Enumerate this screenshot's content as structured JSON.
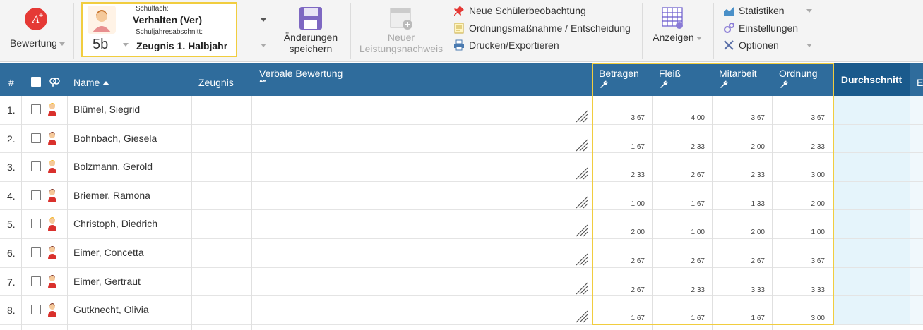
{
  "toolbar": {
    "bewertung_label": "Bewertung",
    "schulfach_caption": "Schulfach:",
    "schulfach_value": "Verhalten (Ver)",
    "abschnitt_caption": "Schuljahresabschnitt:",
    "abschnitt_value": "Zeugnis 1. Halbjahr",
    "klasse": "5b",
    "save_line1": "Änderungen",
    "save_line2": "speichern",
    "neuer_line1": "Neuer",
    "neuer_line2": "Leistungsnachweis",
    "link1": "Neue Schülerbeobachtung",
    "link2": "Ordnungsmaßnahme / Entscheidung",
    "link3": "Drucken/Exportieren",
    "anzeigen": "Anzeigen",
    "statistiken": "Statistiken",
    "einstellungen": "Einstellungen",
    "optionen": "Optionen",
    "colors": {
      "accent": "#2f6c9c",
      "highlight": "#f1cd3f",
      "avg": "#1a5a8c"
    }
  },
  "table": {
    "headers": {
      "num": "#",
      "name": "Name",
      "zeugnis": "Zeugnis",
      "verbal": "Verbale Bewertung",
      "verbal_quote": "❝❞",
      "betragen": "Betragen",
      "fleiss": "Fleiß",
      "mitarbeit": "Mitarbeit",
      "ordnung": "Ordnung",
      "durchschnitt": "Durchschnitt",
      "cut": "E"
    },
    "rows": [
      {
        "num": "1.",
        "name": "Blümel, Siegrid",
        "gender": "f",
        "g": [
          "3.67",
          "4.00",
          "3.67",
          "3.67"
        ]
      },
      {
        "num": "2.",
        "name": "Bohnbach, Giesela",
        "gender": "m",
        "g": [
          "1.67",
          "2.33",
          "2.00",
          "2.33"
        ]
      },
      {
        "num": "3.",
        "name": "Bolzmann, Gerold",
        "gender": "f",
        "g": [
          "2.33",
          "2.67",
          "2.33",
          "3.00"
        ]
      },
      {
        "num": "4.",
        "name": "Briemer, Ramona",
        "gender": "m",
        "g": [
          "1.00",
          "1.67",
          "1.33",
          "2.00"
        ]
      },
      {
        "num": "5.",
        "name": "Christoph, Diedrich",
        "gender": "f",
        "g": [
          "2.00",
          "1.00",
          "2.00",
          "1.00"
        ]
      },
      {
        "num": "6.",
        "name": "Eimer, Concetta",
        "gender": "m",
        "g": [
          "2.67",
          "2.67",
          "2.67",
          "3.67"
        ]
      },
      {
        "num": "7.",
        "name": "Eimer, Gertraut",
        "gender": "m",
        "g": [
          "2.67",
          "2.33",
          "3.33",
          "3.33"
        ]
      },
      {
        "num": "8.",
        "name": "Gutknecht, Olivia",
        "gender": "m",
        "g": [
          "1.67",
          "1.67",
          "1.67",
          "3.00"
        ]
      }
    ]
  }
}
